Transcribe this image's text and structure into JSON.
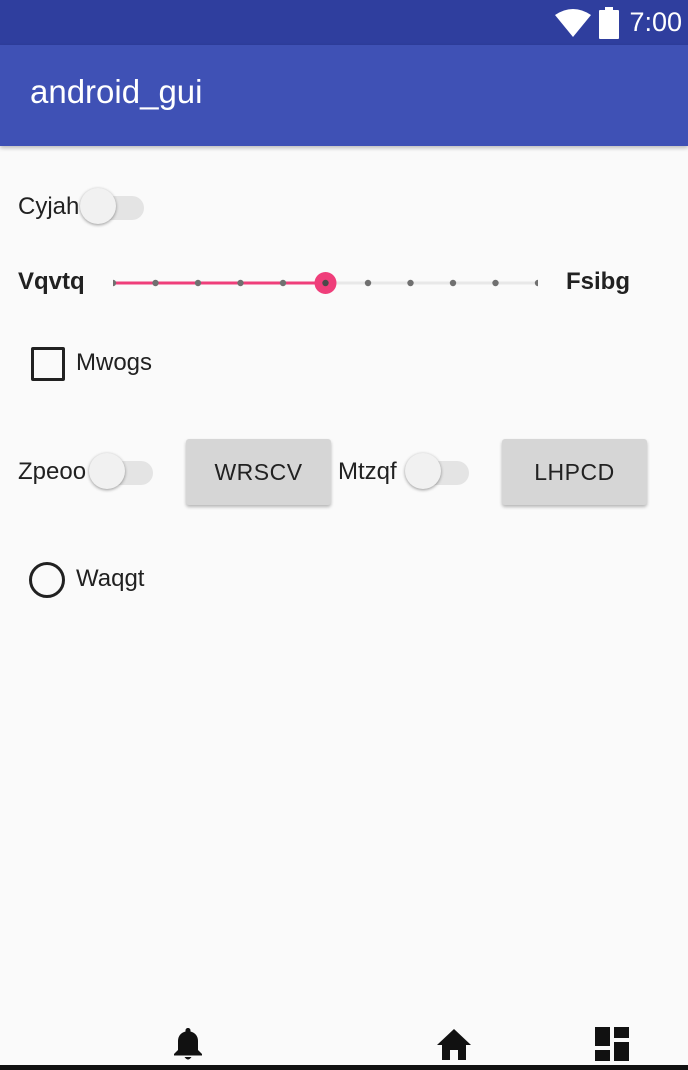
{
  "status_bar": {
    "time": "7:00",
    "icons": [
      "wifi-icon",
      "battery-icon"
    ],
    "background": "#2f3e9e"
  },
  "app_bar": {
    "title": "android_gui",
    "background": "#3f51b5"
  },
  "controls": {
    "switch_cyjah": {
      "label": "Cyjah",
      "checked": false
    },
    "slider": {
      "left_label": "Vqvtq",
      "right_label": "Fsibg",
      "value": 5,
      "max": 10,
      "accent_color": "#ef3e7a"
    },
    "checkbox_mwogs": {
      "label": "Mwogs",
      "checked": false
    },
    "switch_zpeoo": {
      "label": "Zpeoo",
      "checked": false
    },
    "button_wrscv": {
      "label": "WRSCV"
    },
    "switch_mtzqf": {
      "label": "Mtzqf",
      "checked": false
    },
    "button_lhpcd": {
      "label": "LHPCD"
    },
    "radio_waqgt": {
      "label": "Waqgt",
      "checked": false
    }
  },
  "bottom_nav": {
    "items": [
      "bell-icon",
      "home-icon",
      "dashboard-icon"
    ]
  }
}
